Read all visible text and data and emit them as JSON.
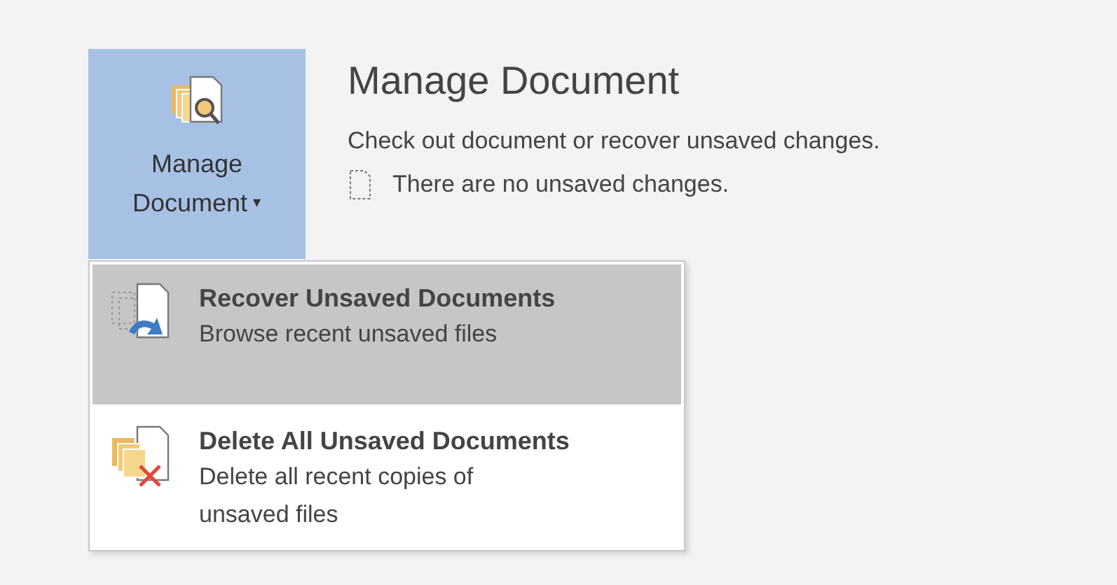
{
  "button": {
    "label_line_1": "Manage",
    "label_line_2": "Document",
    "caret": "▾"
  },
  "section": {
    "title": "Manage Document",
    "description": "Check out document or recover unsaved changes.",
    "status": "There are no unsaved changes."
  },
  "menu": [
    {
      "kind": "recover",
      "title": "Recover Unsaved Documents",
      "subtitle": "Browse recent unsaved files",
      "selected": true
    },
    {
      "kind": "delete",
      "title": "Delete All Unsaved Documents",
      "subtitle": "Delete all recent copies of unsaved files",
      "selected": false
    }
  ]
}
